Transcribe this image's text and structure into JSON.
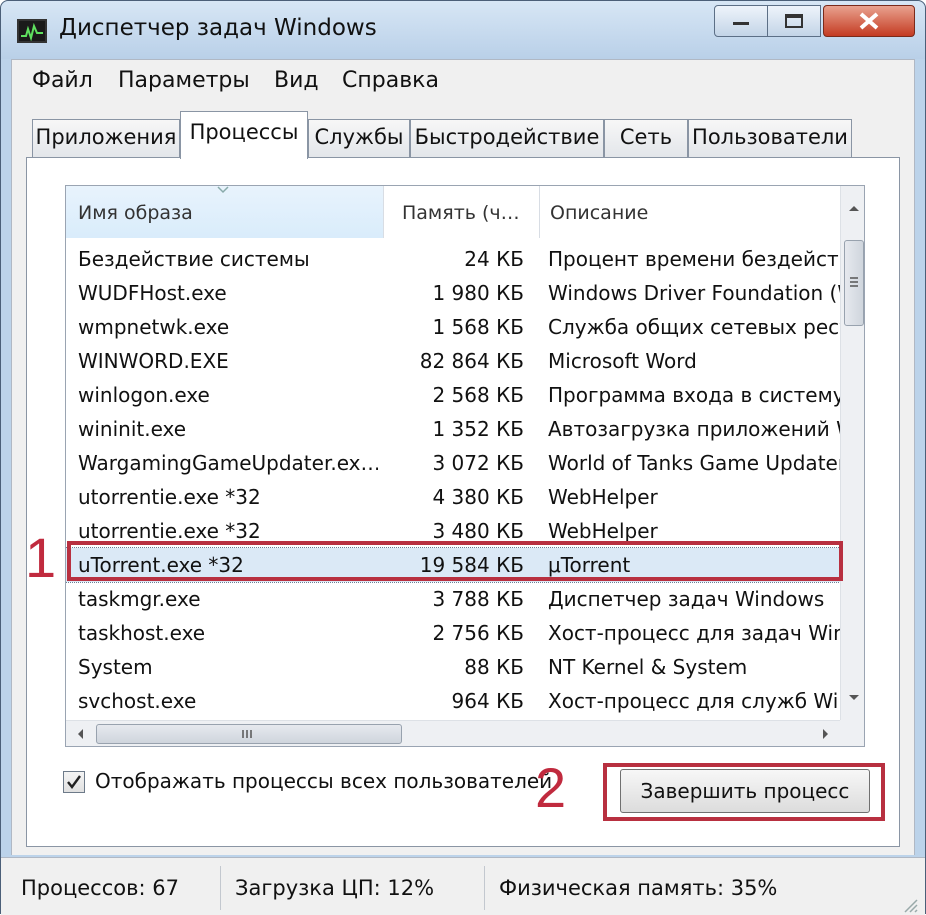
{
  "window": {
    "title": "Диспетчер задач Windows"
  },
  "menu": [
    "Файл",
    "Параметры",
    "Вид",
    "Справка"
  ],
  "tabs": [
    {
      "label": "Приложения",
      "active": false
    },
    {
      "label": "Процессы",
      "active": true
    },
    {
      "label": "Службы",
      "active": false
    },
    {
      "label": "Быстродействие",
      "active": false
    },
    {
      "label": "Сеть",
      "active": false
    },
    {
      "label": "Пользователи",
      "active": false
    }
  ],
  "columns": {
    "name": "Имя образа",
    "memory": "Память (ч…",
    "description": "Описание"
  },
  "processes": [
    {
      "name": "Бездействие системы",
      "memory": "24 КБ",
      "description": "Процент времени бездействия"
    },
    {
      "name": "WUDFHost.exe",
      "memory": "1 980 КБ",
      "description": "Windows Driver Foundation (W"
    },
    {
      "name": "wmpnetwk.exe",
      "memory": "1 568 КБ",
      "description": "Служба общих сетевых ресу"
    },
    {
      "name": "WINWORD.EXE",
      "memory": "82 864 КБ",
      "description": "Microsoft Word"
    },
    {
      "name": "winlogon.exe",
      "memory": "2 568 КБ",
      "description": "Программа входа в систему"
    },
    {
      "name": "wininit.exe",
      "memory": "1 352 КБ",
      "description": "Автозагрузка приложений W"
    },
    {
      "name": "WargamingGameUpdater.ex…",
      "memory": "3 072 КБ",
      "description": "World of Tanks Game Updater"
    },
    {
      "name": "utorrentie.exe *32",
      "memory": "4 380 КБ",
      "description": "WebHelper"
    },
    {
      "name": "utorrentie.exe *32",
      "memory": "3 480 КБ",
      "description": "WebHelper"
    },
    {
      "name": "uTorrent.exe *32",
      "memory": "19 584 КБ",
      "description": "μTorrent",
      "selected": true
    },
    {
      "name": "taskmgr.exe",
      "memory": "3 788 КБ",
      "description": "Диспетчер задач Windows"
    },
    {
      "name": "taskhost.exe",
      "memory": "2 756 КБ",
      "description": "Хост-процесс для задач Win"
    },
    {
      "name": "System",
      "memory": "88 КБ",
      "description": "NT Kernel & System"
    },
    {
      "name": "svchost.exe",
      "memory": "964 КБ",
      "description": "Хост-процесс для служб Win"
    }
  ],
  "show_all_users": {
    "label": "Отображать процессы всех пользователей",
    "checked": true
  },
  "end_process_button": "Завершить процесс",
  "annotations": {
    "step1": "1",
    "step2": "2"
  },
  "status": {
    "processes": "Процессов: 67",
    "cpu": "Загрузка ЦП: 12%",
    "memory": "Физическая память: 35%"
  },
  "colors": {
    "annotation": "#c02a3e",
    "selection": "#dbe9f6",
    "close_button": "#c43b22"
  }
}
